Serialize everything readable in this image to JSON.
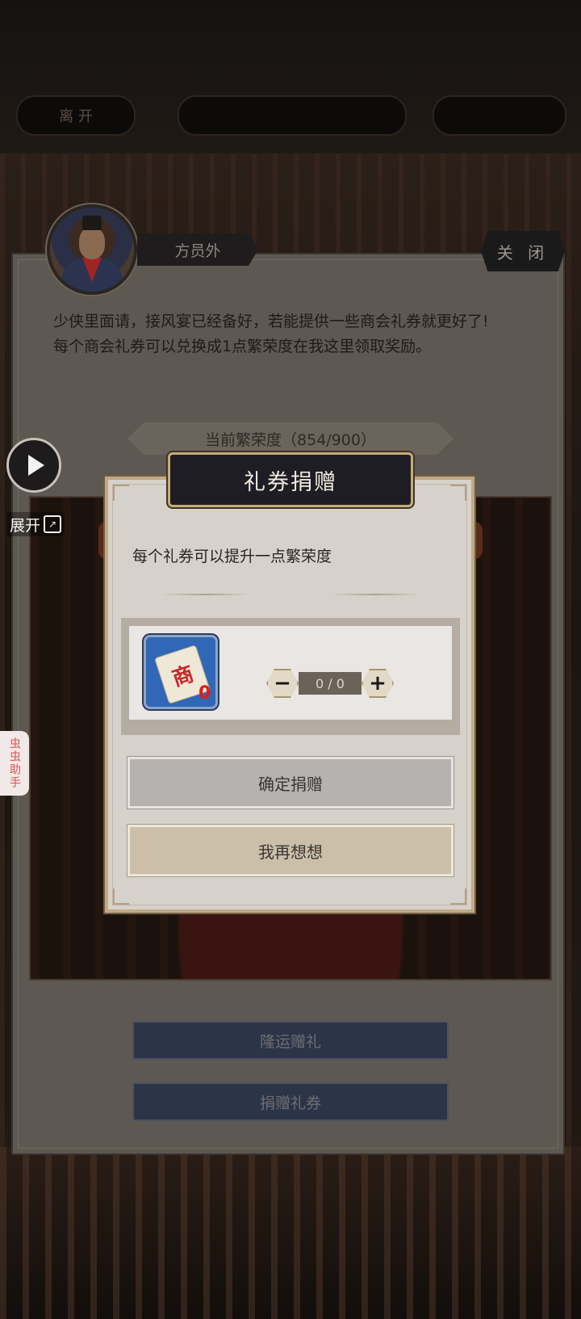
{
  "top_bar": {
    "left": "离 开",
    "middle": "",
    "right": ""
  },
  "npc": {
    "name": "方员外",
    "avatar": "merchant-portrait"
  },
  "close_label": "关 闭",
  "dialog": {
    "line1": "少侠里面请，接风宴已经备好，若能提供一些商会礼券就更好了!",
    "line2": "每个商会礼券可以兑换成1点繁荣度在我这里领取奖励。"
  },
  "prosperity_label": "当前繁荣度（854/900）",
  "main_buttons": {
    "gift": "隆运赠礼",
    "donate": "捐赠礼券"
  },
  "side": {
    "play_icon": "play-icon",
    "expand_label": "展开",
    "helper_label": "虫虫助手"
  },
  "popup": {
    "title": "礼券捐赠",
    "description": "每个礼券可以提升一点繁荣度",
    "item": {
      "icon": "merchant-voucher-icon",
      "glyph": "商",
      "count": "0"
    },
    "stepper": {
      "minus": "−",
      "value": "0 / 0",
      "plus": "+"
    },
    "confirm_label": "确定捐赠",
    "think_label": "我再想想"
  }
}
